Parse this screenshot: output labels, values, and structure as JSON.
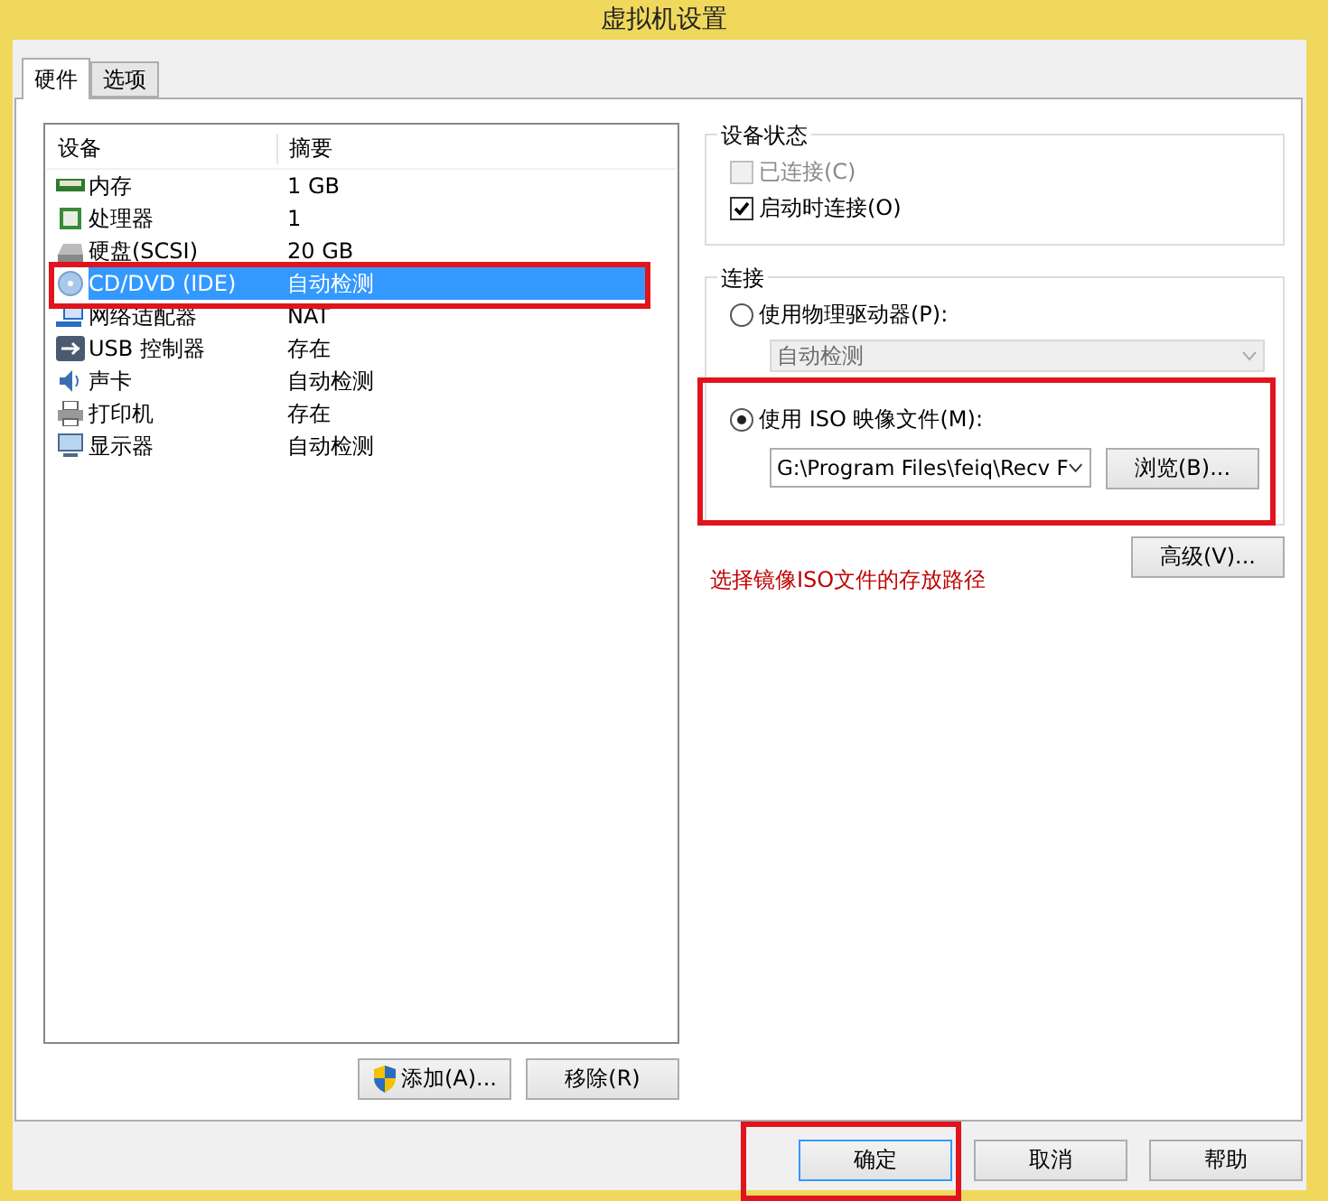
{
  "window": {
    "title": "虚拟机设置"
  },
  "tabs": [
    {
      "label": "硬件",
      "selected": true
    },
    {
      "label": "选项",
      "selected": false
    }
  ],
  "device_list": {
    "columns": [
      "设备",
      "摘要"
    ],
    "rows": [
      {
        "kind": "memory",
        "device": "内存",
        "summary": "1 GB",
        "selected": false,
        "annotated": false
      },
      {
        "kind": "cpu",
        "device": "处理器",
        "summary": "1",
        "selected": false,
        "annotated": false
      },
      {
        "kind": "disk",
        "device": "硬盘(SCSI)",
        "summary": "20 GB",
        "selected": false,
        "annotated": false
      },
      {
        "kind": "cd",
        "device": "CD/DVD (IDE)",
        "summary": "自动检测",
        "selected": true,
        "annotated": true
      },
      {
        "kind": "network",
        "device": "网络适配器",
        "summary": "NAT",
        "selected": false,
        "annotated": false
      },
      {
        "kind": "usb",
        "device": "USB 控制器",
        "summary": "存在",
        "selected": false,
        "annotated": false
      },
      {
        "kind": "sound",
        "device": "声卡",
        "summary": "自动检测",
        "selected": false,
        "annotated": false
      },
      {
        "kind": "printer",
        "device": "打印机",
        "summary": "存在",
        "selected": false,
        "annotated": false
      },
      {
        "kind": "display",
        "device": "显示器",
        "summary": "自动检测",
        "selected": false,
        "annotated": false
      }
    ]
  },
  "list_buttons": [
    {
      "label": "添加(A)...",
      "shield": true
    },
    {
      "label": "移除(R)",
      "shield": false
    }
  ],
  "device_status": {
    "title": "设备状态",
    "options": [
      {
        "label": "已连接(C)",
        "checked": false,
        "disabled": true
      },
      {
        "label": "启动时连接(O)",
        "checked": true,
        "disabled": false
      }
    ]
  },
  "connection": {
    "title": "连接",
    "physical": {
      "label": "使用物理驱动器(P):",
      "selected": false,
      "dropdown": "自动检测",
      "disabled": true
    },
    "iso": {
      "label": "使用 ISO 映像文件(M):",
      "selected": true,
      "path": "G:\\Program Files\\feiq\\Recv F",
      "browse": "浏览(B)...",
      "annotated": true
    }
  },
  "advanced_button": "高级(V)...",
  "annotation_note": "选择镜像ISO文件的存放路径",
  "dialog_buttons": [
    {
      "label": "确定",
      "default": true,
      "annotated": true
    },
    {
      "label": "取消",
      "default": false,
      "annotated": false
    },
    {
      "label": "帮助",
      "default": false,
      "annotated": false
    }
  ]
}
